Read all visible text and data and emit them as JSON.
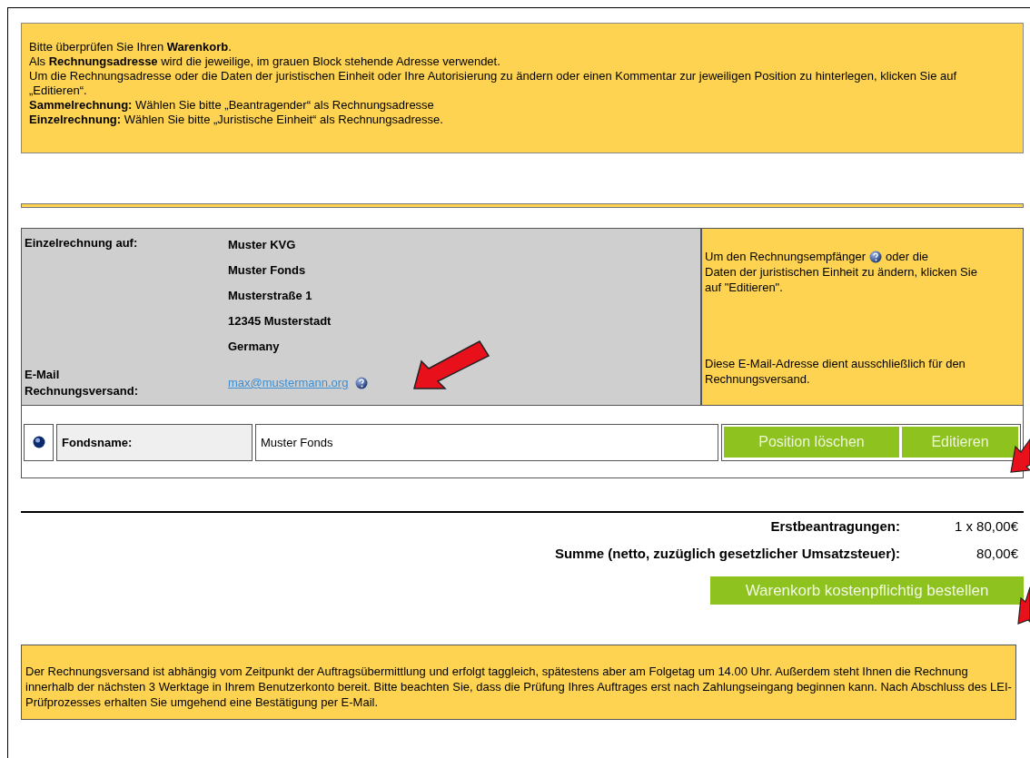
{
  "intro": {
    "lines": [
      "Bitte überprüfen Sie Ihren **Warenkorb**.",
      "Als **Rechnungsadresse** wird die jeweilige, im grauen Block stehende Adresse verwendet.",
      "Um die Rechnungsadresse oder die Daten der juristischen Einheit oder Ihre Autorisierung zu ändern oder einen Kommentar zur jeweiligen Position zu hinterlegen, klicken Sie auf „Editieren“.",
      "**Sammelrechnung:** Wählen Sie bitte „Beantragender“ als Rechnungsadresse",
      "**Einzelrechnung:** Wählen Sie bitte „Juristische Einheit“ als Rechnungsadresse."
    ]
  },
  "invoice": {
    "address_label": "Einzelrechnung auf:",
    "address_lines": [
      "Muster KVG",
      "Muster Fonds",
      "Musterstraße 1",
      "12345 Musterstadt",
      "Germany"
    ],
    "email_label": "E-Mail Rechnungsversand:",
    "email": "max@mustermann.org",
    "hint_recipient_before": "Um den Rechnungsempfänger",
    "hint_recipient_after": "oder die",
    "hint_recipient_rest": "Daten der juristischen Einheit zu ändern, klicken Sie auf \"Editieren\".",
    "hint_email": "Diese E-Mail-Adresse dient ausschließlich für den Rechnungsversand."
  },
  "position": {
    "label": "Fondsname:",
    "value": "Muster Fonds",
    "buttons": [
      "Position löschen",
      "Editieren"
    ]
  },
  "totals": [
    {
      "label": "Erstbeantragungen:",
      "value": "1 x 80,00€"
    },
    {
      "label": "Summe (netto, zuzüglich gesetzlicher Umsatzsteuer):",
      "value": "80,00€"
    }
  ],
  "order_button": "Warenkorb kostenpflichtig bestellen",
  "notice": "Der Rechnungsversand ist abhängig vom Zeitpunkt der Auftragsübermittlung und erfolgt taggleich, spätestens aber am Folgetag um 14.00 Uhr. Außerdem steht Ihnen die Rechnung innerhalb der nächsten 3 Werktage in Ihrem Benutzerkonto bereit. Bitte beachten Sie, dass die Prüfung Ihres Auftrages erst nach Zahlungseingang beginnen kann. Nach Abschluss des LEI-Prüfprozesses erhalten Sie umgehend eine Bestätigung per E-Mail."
}
